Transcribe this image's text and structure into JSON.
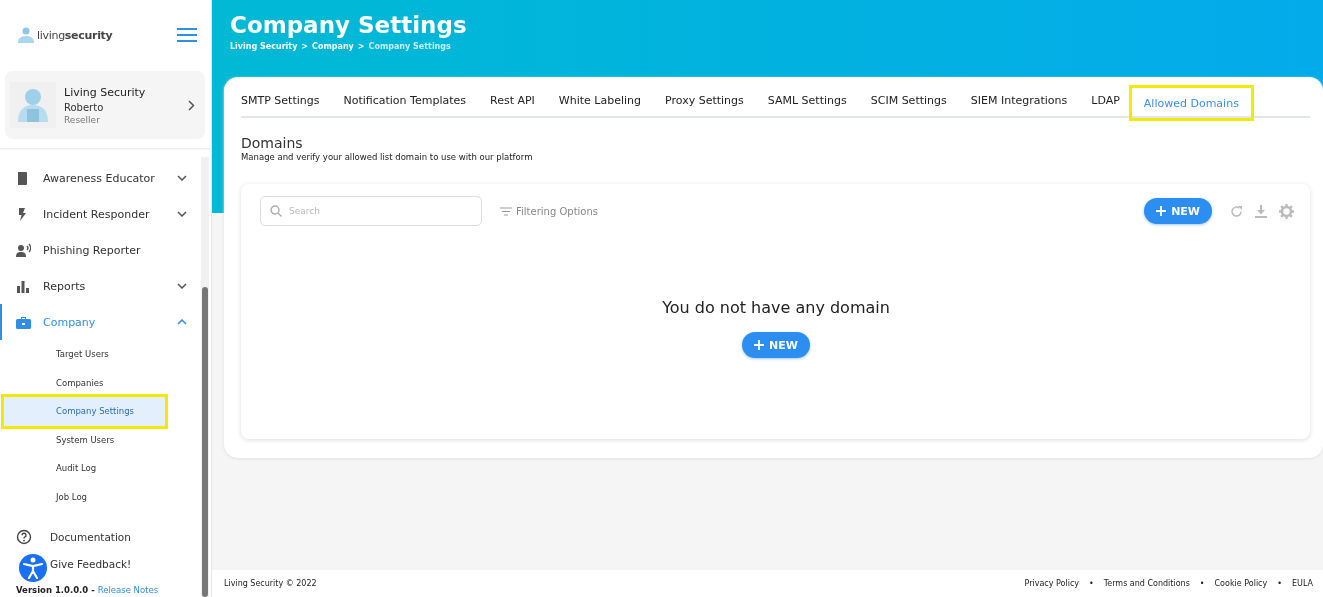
{
  "sidebar": {
    "logo": "living**security**",
    "profile": {
      "name": "Living Security",
      "user": "Roberto",
      "role": "Reseller"
    },
    "items": [
      {
        "label": "Awareness Educator",
        "kind": "group",
        "expanded": false,
        "selected": false
      },
      {
        "label": "Incident Responder",
        "kind": "group",
        "expanded": false,
        "selected": false
      },
      {
        "label": "Phishing Reporter",
        "kind": "link",
        "selected": false
      },
      {
        "label": "Reports",
        "kind": "group",
        "expanded": false,
        "selected": false
      },
      {
        "label": "Company",
        "kind": "group",
        "expanded": true,
        "selected": true,
        "children": [
          {
            "label": "Target Users",
            "selected": false,
            "highlighted": false
          },
          {
            "label": "Companies",
            "selected": false,
            "highlighted": false
          },
          {
            "label": "Company Settings",
            "selected": true,
            "highlighted": true
          },
          {
            "label": "System Users",
            "selected": false,
            "highlighted": false
          },
          {
            "label": "Audit Log",
            "selected": false,
            "highlighted": false
          },
          {
            "label": "Job Log",
            "selected": false,
            "highlighted": false
          }
        ]
      }
    ],
    "links": [
      {
        "label": "Documentation"
      },
      {
        "label": "Give Feedback!"
      }
    ],
    "version": "Version 1.0.0.0 - ",
    "release_notes": "Release Notes"
  },
  "header": {
    "title": "Company Settings",
    "breadcrumb": [
      {
        "label": "Living Security",
        "current": false
      },
      {
        "label": "Company",
        "current": false
      },
      {
        "label": "Company Settings",
        "current": true
      }
    ],
    "separator": ">"
  },
  "tabs": [
    {
      "label": "SMTP Settings",
      "selected": false,
      "highlighted": false
    },
    {
      "label": "Notification Templates",
      "selected": false,
      "highlighted": false
    },
    {
      "label": "Rest API",
      "selected": false,
      "highlighted": false
    },
    {
      "label": "White Labeling",
      "selected": false,
      "highlighted": false
    },
    {
      "label": "Proxy Settings",
      "selected": false,
      "highlighted": false
    },
    {
      "label": "SAML Settings",
      "selected": false,
      "highlighted": false
    },
    {
      "label": "SCIM Settings",
      "selected": false,
      "highlighted": false
    },
    {
      "label": "SIEM Integrations",
      "selected": false,
      "highlighted": false
    },
    {
      "label": "LDAP",
      "selected": false,
      "highlighted": false
    },
    {
      "label": "Allowed Domains",
      "selected": true,
      "highlighted": true
    }
  ],
  "section": {
    "title": "Domains",
    "subtitle": "Manage and verify your allowed list domain to use with our platform"
  },
  "toolbar": {
    "search": {
      "placeholder": "Search"
    },
    "filter": "Filtering Options",
    "new_button": "NEW"
  },
  "empty_state": {
    "message": "You do not have any domain",
    "button": "NEW"
  },
  "footer": {
    "copyright": "Living Security © 2022",
    "links": [
      "Privacy Policy",
      "Terms and Conditions",
      "Cookie Policy",
      "EULA"
    ],
    "separator": "•"
  }
}
